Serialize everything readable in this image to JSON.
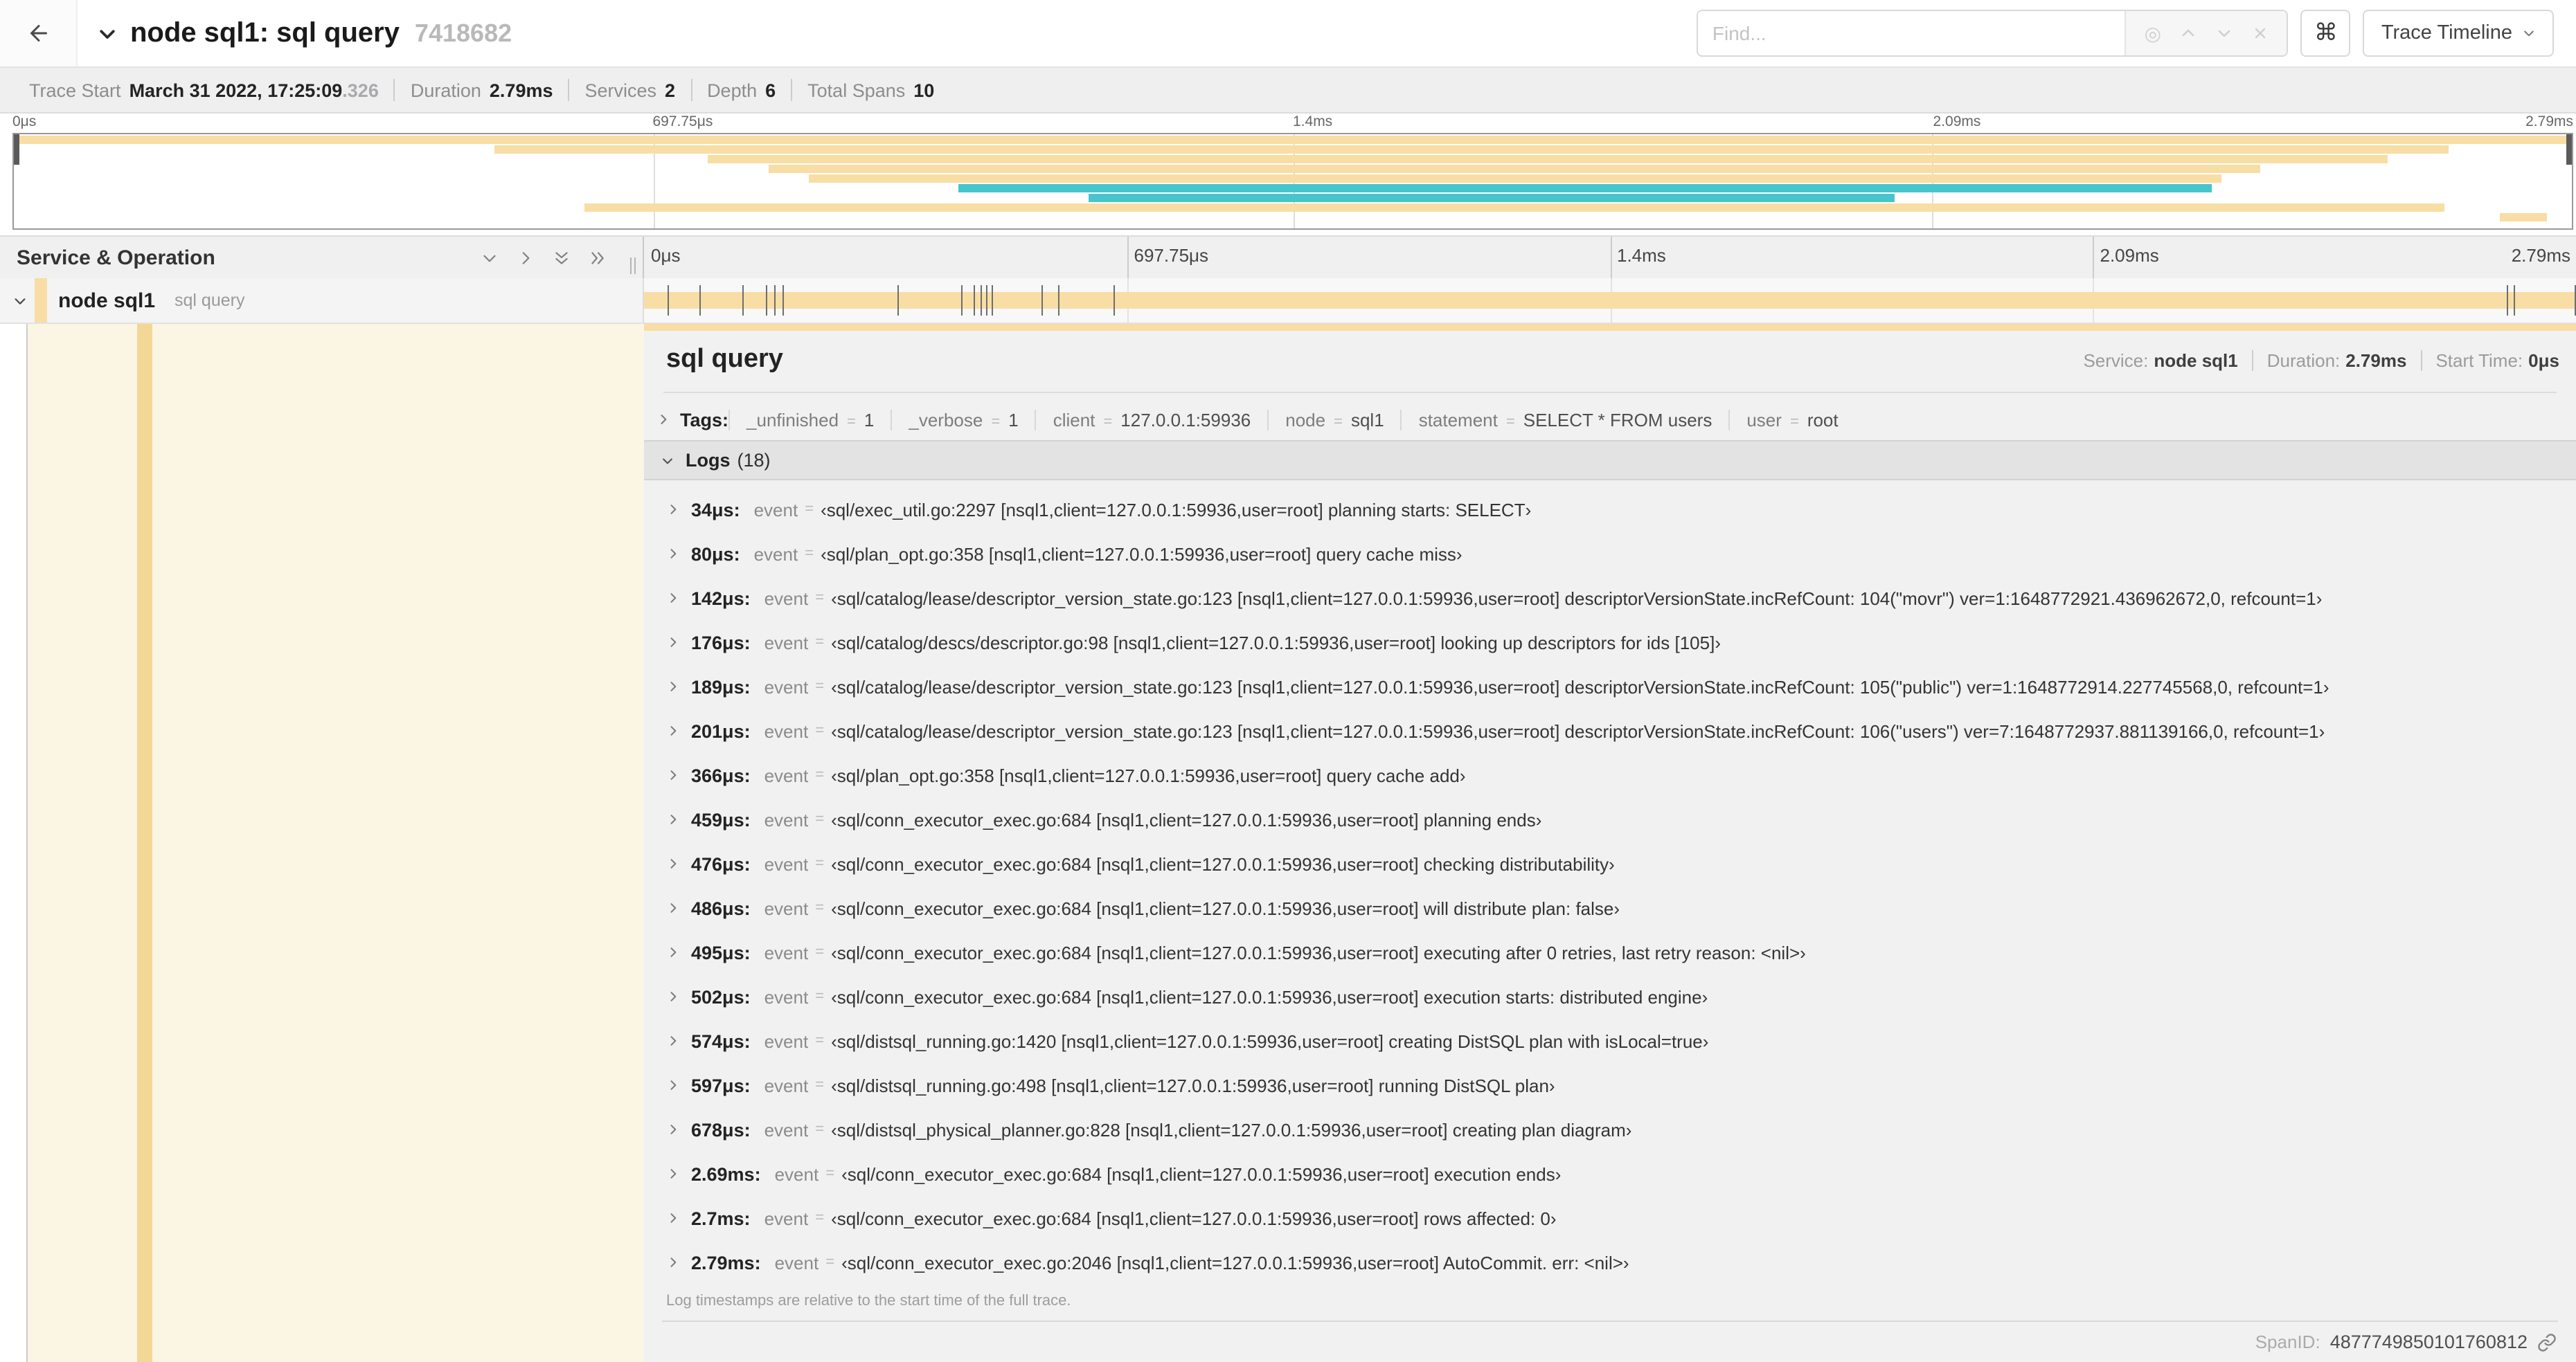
{
  "header": {
    "title": "node sql1: sql query",
    "trace_id_short": "7418682",
    "find_placeholder": "Find...",
    "shortcut_key": "⌘",
    "view_selector_label": "Trace Timeline"
  },
  "trace_info": {
    "trace_start_label": "Trace Start",
    "trace_start_value": "March 31 2022, 17:25:09",
    "trace_start_fraction": ".326",
    "duration_label": "Duration",
    "duration_value": "2.79ms",
    "services_label": "Services",
    "services_value": "2",
    "depth_label": "Depth",
    "depth_value": "6",
    "total_spans_label": "Total Spans",
    "total_spans_value": "10"
  },
  "timeline": {
    "ticks": [
      {
        "label": "0μs",
        "pos": 0
      },
      {
        "label": "697.75μs",
        "pos": 25
      },
      {
        "label": "1.4ms",
        "pos": 50
      },
      {
        "label": "2.09ms",
        "pos": 75
      },
      {
        "label": "2.79ms",
        "pos": 100
      }
    ],
    "colors": {
      "tan": "#F8DDA4",
      "teal": "#48C5CC"
    },
    "minimap_spans": [
      {
        "row": 0,
        "start": 0,
        "end": 100,
        "color": "tan"
      },
      {
        "row": 1,
        "start": 18.8,
        "end": 95.2,
        "color": "tan"
      },
      {
        "row": 2,
        "start": 27.1,
        "end": 92.8,
        "color": "tan"
      },
      {
        "row": 3,
        "start": 29.5,
        "end": 87.8,
        "color": "tan"
      },
      {
        "row": 4,
        "start": 31.1,
        "end": 86.3,
        "color": "tan"
      },
      {
        "row": 5,
        "start": 36.9,
        "end": 85.9,
        "color": "teal"
      },
      {
        "row": 6,
        "start": 42.0,
        "end": 73.5,
        "color": "teal"
      },
      {
        "row": 7,
        "start": 22.3,
        "end": 95.0,
        "color": "tan"
      },
      {
        "row": 8,
        "start": 97.2,
        "end": 99.0,
        "color": "tan"
      }
    ],
    "log_tick_positions_pct": [
      1.22,
      2.87,
      5.09,
      6.31,
      6.77,
      7.2,
      13.12,
      16.45,
      17.06,
      17.42,
      17.74,
      18.0,
      20.57,
      21.4,
      24.3,
      96.42,
      96.77,
      99.9
    ]
  },
  "span_table": {
    "header_label": "Service & Operation",
    "service": "node sql1",
    "operation": "sql query"
  },
  "detail": {
    "operation": "sql query",
    "service_label": "Service:",
    "service_value": "node sql1",
    "duration_label": "Duration:",
    "duration_value": "2.79ms",
    "start_time_label": "Start Time:",
    "start_time_value": "0μs",
    "tags_label": "Tags:",
    "equals_sign": "=",
    "tags": [
      {
        "key": "_unfinished",
        "value": "1"
      },
      {
        "key": "_verbose",
        "value": "1"
      },
      {
        "key": "client",
        "value": "127.0.0.1:59936"
      },
      {
        "key": "node",
        "value": "sql1"
      },
      {
        "key": "statement",
        "value": "SELECT * FROM users"
      },
      {
        "key": "user",
        "value": "root"
      }
    ],
    "logs_label": "Logs",
    "logs_count": "(18)",
    "logs_field_label": "event",
    "logs": [
      {
        "time": "34μs:",
        "value": "‹sql/exec_util.go:2297 [nsql1,client=127.0.0.1:59936,user=root] planning starts: SELECT›"
      },
      {
        "time": "80μs:",
        "value": "‹sql/plan_opt.go:358 [nsql1,client=127.0.0.1:59936,user=root] query cache miss›"
      },
      {
        "time": "142μs:",
        "value": "‹sql/catalog/lease/descriptor_version_state.go:123 [nsql1,client=127.0.0.1:59936,user=root] descriptorVersionState.incRefCount: 104(\"movr\") ver=1:1648772921.436962672,0, refcount=1›"
      },
      {
        "time": "176μs:",
        "value": "‹sql/catalog/descs/descriptor.go:98 [nsql1,client=127.0.0.1:59936,user=root] looking up descriptors for ids [105]›"
      },
      {
        "time": "189μs:",
        "value": "‹sql/catalog/lease/descriptor_version_state.go:123 [nsql1,client=127.0.0.1:59936,user=root] descriptorVersionState.incRefCount: 105(\"public\") ver=1:1648772914.227745568,0, refcount=1›"
      },
      {
        "time": "201μs:",
        "value": "‹sql/catalog/lease/descriptor_version_state.go:123 [nsql1,client=127.0.0.1:59936,user=root] descriptorVersionState.incRefCount: 106(\"users\") ver=7:1648772937.881139166,0, refcount=1›"
      },
      {
        "time": "366μs:",
        "value": "‹sql/plan_opt.go:358 [nsql1,client=127.0.0.1:59936,user=root] query cache add›"
      },
      {
        "time": "459μs:",
        "value": "‹sql/conn_executor_exec.go:684 [nsql1,client=127.0.0.1:59936,user=root] planning ends›"
      },
      {
        "time": "476μs:",
        "value": "‹sql/conn_executor_exec.go:684 [nsql1,client=127.0.0.1:59936,user=root] checking distributability›"
      },
      {
        "time": "486μs:",
        "value": "‹sql/conn_executor_exec.go:684 [nsql1,client=127.0.0.1:59936,user=root] will distribute plan: false›"
      },
      {
        "time": "495μs:",
        "value": "‹sql/conn_executor_exec.go:684 [nsql1,client=127.0.0.1:59936,user=root] executing after 0 retries, last retry reason: <nil>›"
      },
      {
        "time": "502μs:",
        "value": "‹sql/conn_executor_exec.go:684 [nsql1,client=127.0.0.1:59936,user=root] execution starts: distributed engine›"
      },
      {
        "time": "574μs:",
        "value": "‹sql/distsql_running.go:1420 [nsql1,client=127.0.0.1:59936,user=root] creating DistSQL plan with isLocal=true›"
      },
      {
        "time": "597μs:",
        "value": "‹sql/distsql_running.go:498 [nsql1,client=127.0.0.1:59936,user=root] running DistSQL plan›"
      },
      {
        "time": "678μs:",
        "value": "‹sql/distsql_physical_planner.go:828 [nsql1,client=127.0.0.1:59936,user=root] creating plan diagram›"
      },
      {
        "time": "2.69ms:",
        "value": "‹sql/conn_executor_exec.go:684 [nsql1,client=127.0.0.1:59936,user=root] execution ends›"
      },
      {
        "time": "2.7ms:",
        "value": "‹sql/conn_executor_exec.go:684 [nsql1,client=127.0.0.1:59936,user=root] rows affected: 0›"
      },
      {
        "time": "2.79ms:",
        "value": "‹sql/conn_executor_exec.go:2046 [nsql1,client=127.0.0.1:59936,user=root] AutoCommit. err: <nil>›"
      }
    ],
    "logs_note": "Log timestamps are relative to the start time of the full trace.",
    "span_id_label": "SpanID:",
    "span_id_value": "4877749850101760812"
  }
}
